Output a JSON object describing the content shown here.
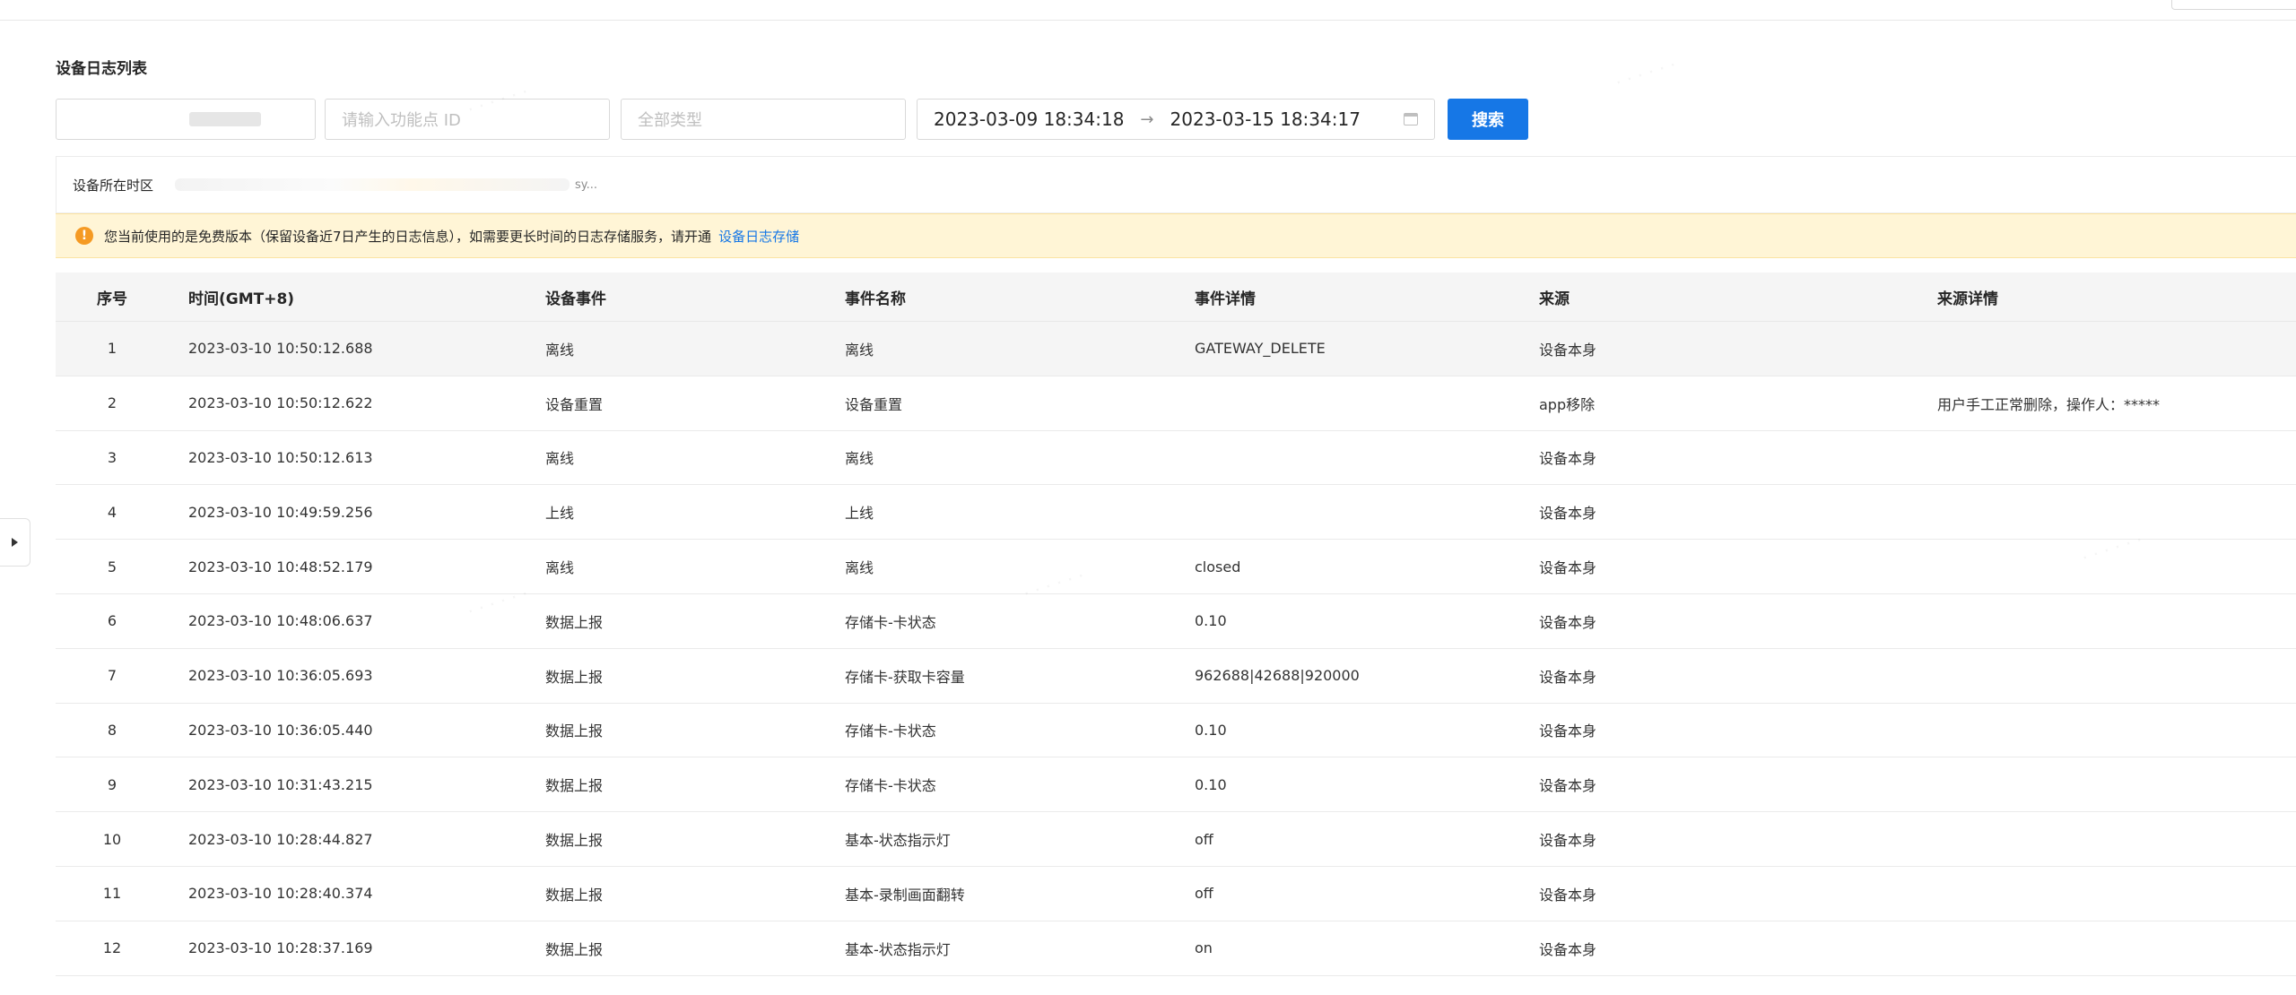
{
  "panel": {
    "title": "设备日志列表"
  },
  "filters": {
    "function_point_placeholder": "请输入功能点 ID",
    "type_select_value": "全部类型",
    "date_start": "2023-03-09  18:34:18",
    "date_separator": "→",
    "date_end": "2023-03-15  18:34:17",
    "search_label": "搜索"
  },
  "timezone": {
    "label": "设备所在时区",
    "suffix": "sy..."
  },
  "notice": {
    "icon": "warning-icon",
    "text": "您当前使用的是免费版本（保留设备近7日产生的日志信息），如需要更长时间的日志存储服务，请开通",
    "link": "设备日志存储"
  },
  "table": {
    "columns": [
      "序号",
      "时间(GMT+8)",
      "设备事件",
      "事件名称",
      "事件详情",
      "来源",
      "来源详情"
    ],
    "rows": [
      {
        "seq": "1",
        "time": "2023-03-10 10:50:12.688",
        "event": "离线",
        "name": "离线",
        "detail": "GATEWAY_DELETE",
        "source": "设备本身",
        "source_detail": ""
      },
      {
        "seq": "2",
        "time": "2023-03-10 10:50:12.622",
        "event": "设备重置",
        "name": "设备重置",
        "detail": "",
        "source": "app移除",
        "source_detail": "用户手工正常删除，操作人：*****"
      },
      {
        "seq": "3",
        "time": "2023-03-10 10:50:12.613",
        "event": "离线",
        "name": "离线",
        "detail": "",
        "source": "设备本身",
        "source_detail": ""
      },
      {
        "seq": "4",
        "time": "2023-03-10 10:49:59.256",
        "event": "上线",
        "name": "上线",
        "detail": "",
        "source": "设备本身",
        "source_detail": ""
      },
      {
        "seq": "5",
        "time": "2023-03-10 10:48:52.179",
        "event": "离线",
        "name": "离线",
        "detail": "closed",
        "source": "设备本身",
        "source_detail": ""
      },
      {
        "seq": "6",
        "time": "2023-03-10 10:48:06.637",
        "event": "数据上报",
        "name": "存储卡-卡状态",
        "detail": "0.10",
        "source": "设备本身",
        "source_detail": ""
      },
      {
        "seq": "7",
        "time": "2023-03-10 10:36:05.693",
        "event": "数据上报",
        "name": "存储卡-获取卡容量",
        "detail": "962688|42688|920000",
        "source": "设备本身",
        "source_detail": ""
      },
      {
        "seq": "8",
        "time": "2023-03-10 10:36:05.440",
        "event": "数据上报",
        "name": "存储卡-卡状态",
        "detail": "0.10",
        "source": "设备本身",
        "source_detail": ""
      },
      {
        "seq": "9",
        "time": "2023-03-10 10:31:43.215",
        "event": "数据上报",
        "name": "存储卡-卡状态",
        "detail": "0.10",
        "source": "设备本身",
        "source_detail": ""
      },
      {
        "seq": "10",
        "time": "2023-03-10 10:28:44.827",
        "event": "数据上报",
        "name": "基本-状态指示灯",
        "detail": "off",
        "source": "设备本身",
        "source_detail": ""
      },
      {
        "seq": "11",
        "time": "2023-03-10 10:28:40.374",
        "event": "数据上报",
        "name": "基本-录制画面翻转",
        "detail": "off",
        "source": "设备本身",
        "source_detail": ""
      },
      {
        "seq": "12",
        "time": "2023-03-10 10:28:37.169",
        "event": "数据上报",
        "name": "基本-状态指示灯",
        "detail": "on",
        "source": "设备本身",
        "source_detail": ""
      }
    ]
  },
  "side_toggle": {
    "icon": "caret-right-icon"
  },
  "colors": {
    "primary": "#1677e6",
    "notice_bg": "#fff5d6",
    "warning": "#f59a23"
  }
}
